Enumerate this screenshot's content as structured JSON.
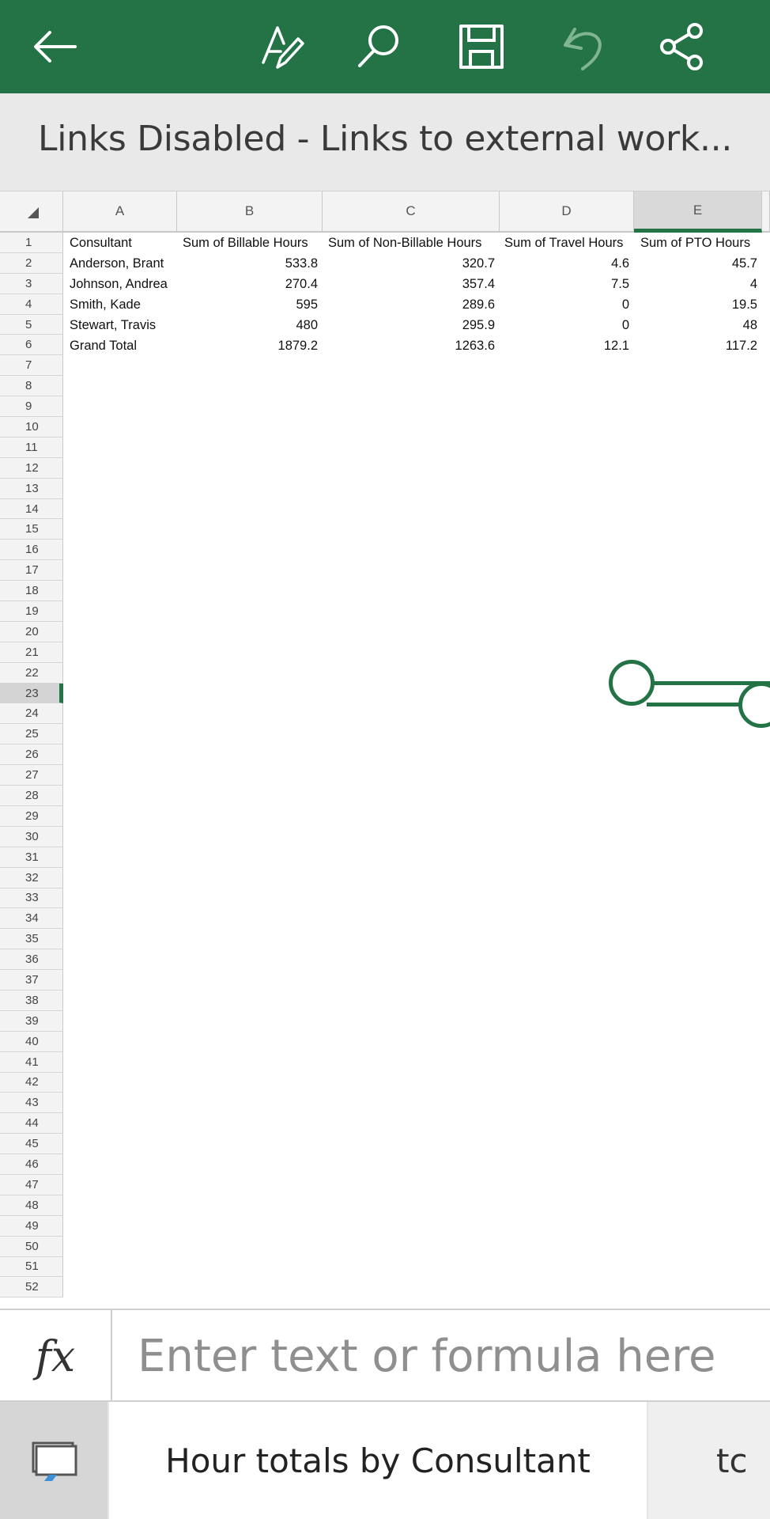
{
  "toolbar": {
    "background": "#237346",
    "icons": [
      "back-arrow-icon",
      "format-pen-icon",
      "search-icon",
      "save-icon",
      "undo-icon",
      "share-icon"
    ]
  },
  "banner": {
    "text": "Links Disabled - Links to external work..."
  },
  "columns": [
    "A",
    "B",
    "C",
    "D",
    "E"
  ],
  "selected_column": "E",
  "selected_row": "23",
  "rows": [
    "1",
    "2",
    "3",
    "4",
    "5",
    "6",
    "7",
    "8",
    "9",
    "10",
    "11",
    "12",
    "13",
    "14",
    "15",
    "16",
    "17",
    "18",
    "19",
    "20",
    "21",
    "22",
    "23",
    "24",
    "25",
    "26",
    "27",
    "28",
    "29",
    "30",
    "31",
    "32",
    "33",
    "34",
    "35",
    "36",
    "37",
    "38",
    "39",
    "40",
    "41",
    "42",
    "43",
    "44",
    "45",
    "46",
    "47",
    "48",
    "49",
    "50",
    "51",
    "52"
  ],
  "table": {
    "headers": [
      "Consultant",
      "Sum of Billable Hours",
      "Sum of Non-Billable Hours",
      "Sum of Travel Hours",
      "Sum of PTO Hours"
    ],
    "rows": [
      [
        "Anderson, Brant",
        "533.8",
        "320.7",
        "4.6",
        "45.7"
      ],
      [
        "Johnson, Andrea",
        "270.4",
        "357.4",
        "7.5",
        "4"
      ],
      [
        "Smith, Kade",
        "595",
        "289.6",
        "0",
        "19.5"
      ],
      [
        "Stewart, Travis",
        "480",
        "295.9",
        "0",
        "48"
      ],
      [
        "Grand Total",
        "1879.2",
        "1263.6",
        "12.1",
        "117.2"
      ]
    ]
  },
  "formula_bar": {
    "fx_label": "fx",
    "placeholder": "Enter text or formula here"
  },
  "sheets": {
    "active_tab": "Hour totals by Consultant",
    "next_tab_partial": "tc"
  }
}
